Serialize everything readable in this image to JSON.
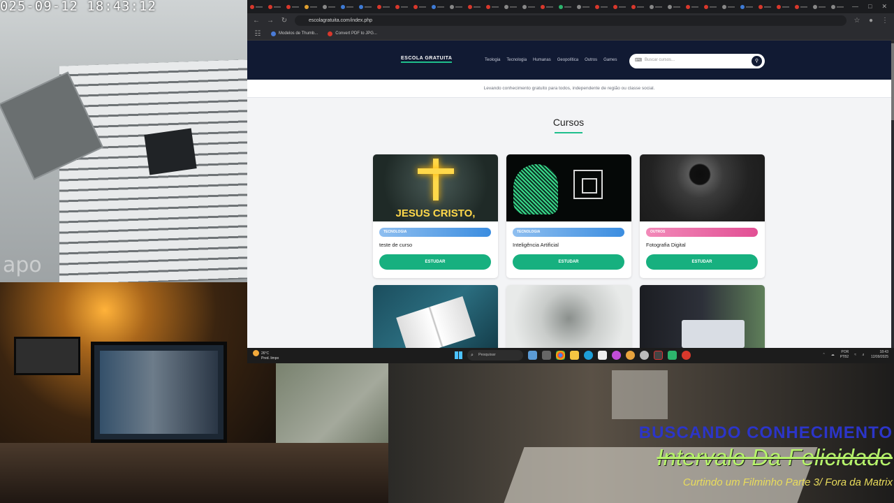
{
  "camera": {
    "timestamp": "025-09-12  18:43:12",
    "watermark": "apo"
  },
  "stream_overlay": {
    "line1": "BUSCANDO CONHECIMENTO",
    "line2": "Intervalo Da Felicidade",
    "line3": "Curtindo um Filminho Parte 3/ Fora da Matrix"
  },
  "browser": {
    "url": "escolagratuita.com/index.php",
    "bookmarks": [
      {
        "label": "Modelos de Thumb...",
        "color": "#4a7bd6"
      },
      {
        "label": "Convert PDF to JPG...",
        "color": "#d9382c"
      }
    ],
    "tab_colors": [
      "#d9382c",
      "#d9382c",
      "#d9382c",
      "#e0a030",
      "#888",
      "#3e7bd6",
      "#3e7bd6",
      "#d9382c",
      "#d9382c",
      "#d9382c",
      "#3e7bd6",
      "#888",
      "#d9382c",
      "#d9382c",
      "#888",
      "#888",
      "#d9382c",
      "#2db46d",
      "#888",
      "#d9382c",
      "#d9382c",
      "#d9382c",
      "#888",
      "#888",
      "#d9382c",
      "#d9382c",
      "#888",
      "#3e7bd6",
      "#d9382c",
      "#d9382c",
      "#d9382c",
      "#888",
      "#888"
    ]
  },
  "site": {
    "logo": "ESCOLA GRATUITA",
    "menu": [
      "Teologia",
      "Tecnologia",
      "Humanas",
      "Geopolítica",
      "Outros",
      "Games"
    ],
    "search_placeholder": "Buscar cursos...",
    "tagline": "Levando conhecimento gratuito para todos, independente de região ou classe social.",
    "section_title": "Cursos",
    "cta_label": "ESTUDAR",
    "cards": [
      {
        "category": "TECNOLOGIA",
        "name": "teste de curso",
        "badge_color": "#3b8de0",
        "thumb_text": "JESUS CRISTO,"
      },
      {
        "category": "TECNOLOGIA",
        "name": "Inteligência Artificial",
        "badge_color": "#3b8de0"
      },
      {
        "category": "OUTROS",
        "name": "Fotografia Digital",
        "badge_color": "#e24f94"
      }
    ]
  },
  "taskbar": {
    "weather_temp": "26°C",
    "weather_desc": "Pred. limpo",
    "search_label": "Pesquisar",
    "lang_top": "POR",
    "lang_bottom": "PTB2",
    "time": "18:43",
    "date": "12/09/2025"
  }
}
